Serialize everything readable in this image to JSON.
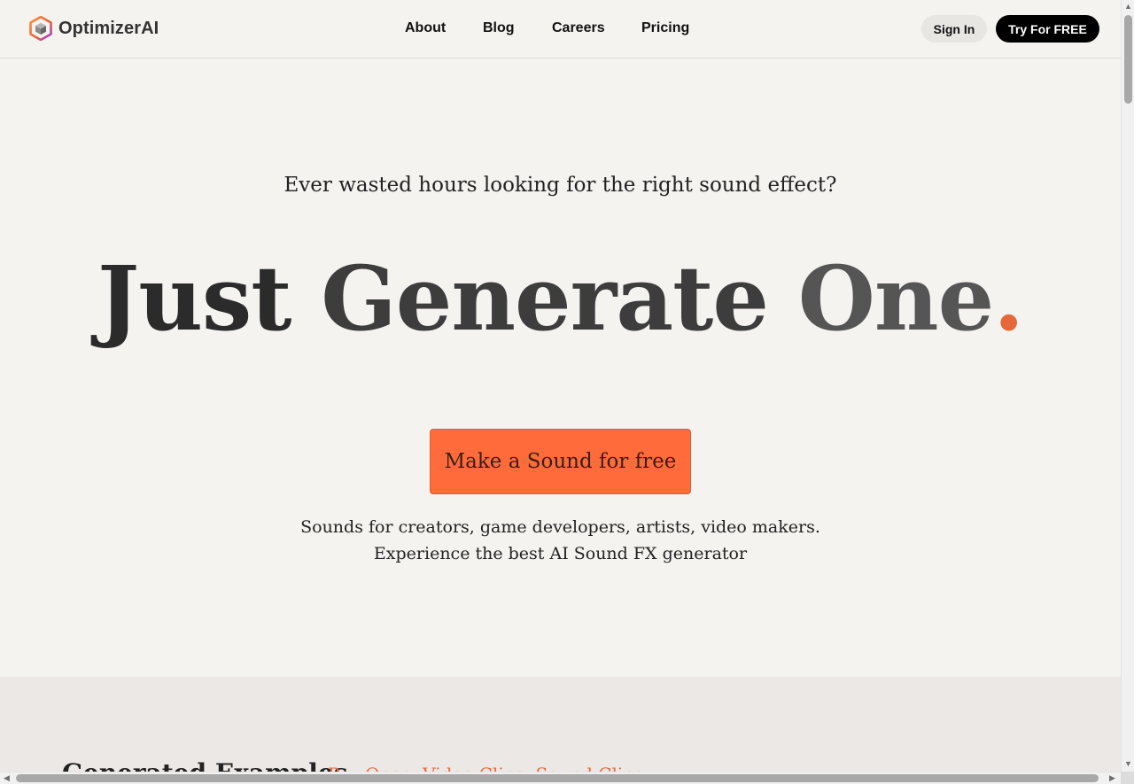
{
  "brand": {
    "name": "OptimizerAI",
    "logo_icon": "hexagon-cube-icon"
  },
  "nav": {
    "items": [
      "About",
      "Blog",
      "Careers",
      "Pricing"
    ]
  },
  "header_actions": {
    "sign_in": "Sign In",
    "try_free": "Try For FREE"
  },
  "hero": {
    "kicker": "Ever wasted hours looking for the right sound effect?",
    "headline_words": [
      "Just",
      "Generate",
      "One"
    ],
    "headline_dot": ".",
    "cta": "Make a Sound for free",
    "subtitle_line1": "Sounds for creators, game developers, artists, video makers.",
    "subtitle_line2": "Experience the best AI Sound FX generator"
  },
  "examples": {
    "title": "Generated Examples",
    "tagline": "Pay Once, Video Clips, Sound Clips"
  },
  "colors": {
    "accent": "#ff6b3b",
    "accent_dot": "#e5683b",
    "page_bg": "#f4f3f0",
    "section_bg": "#ece8e5"
  }
}
